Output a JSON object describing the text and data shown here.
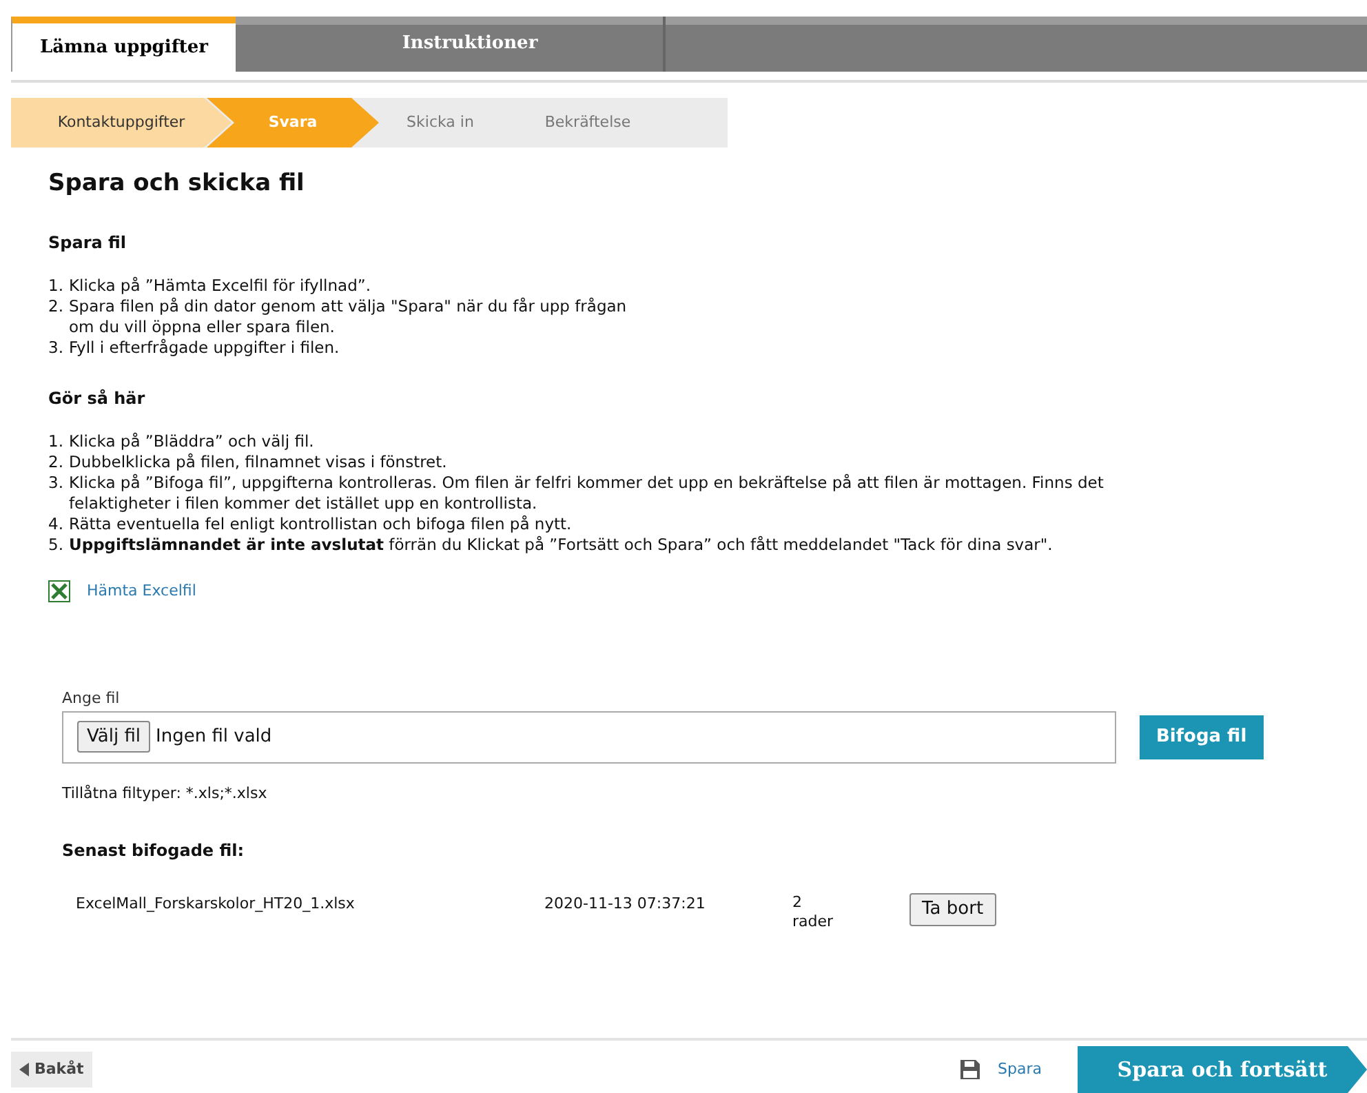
{
  "tabs": [
    {
      "label": "Lämna uppgifter",
      "selected": true
    },
    {
      "label": "Instruktioner",
      "selected": false
    }
  ],
  "steps": [
    {
      "label": "Kontaktuppgifter",
      "kind": "done"
    },
    {
      "label": "Svara",
      "kind": "current"
    },
    {
      "label": "Skicka in",
      "kind": "pending"
    },
    {
      "label": "Bekräftelse",
      "kind": "pending"
    }
  ],
  "title": "Spara och skicka fil",
  "sections": [
    {
      "heading": "Spara fil",
      "items": [
        {
          "number": "1.",
          "text": "Klicka på ”Hämta Excelfil för ifyllnad”."
        },
        {
          "number": "2.",
          "text": "Spara filen på din dator genom att välja \"Spara\" när du får upp frågan om du vill öppna eller spara filen."
        },
        {
          "number": "3.",
          "text": "Fyll i efterfrågade uppgifter i filen."
        }
      ]
    },
    {
      "heading": "Gör så här",
      "items": [
        {
          "number": "1.",
          "text": "Klicka på ”Bläddra” och välj fil."
        },
        {
          "number": "2.",
          "text": "Dubbelklicka på filen, filnamnet visas i fönstret."
        },
        {
          "number": "3.",
          "text": "Klicka på ”Bifoga fil”, uppgifterna kontrolleras. Om filen är felfri kommer det upp en bekräftelse på att filen är mottagen. Finns det felaktigheter i filen kommer det istället upp en kontrollista."
        },
        {
          "number": "4.",
          "text": "Rätta eventuella fel enligt kontrollistan och bifoga filen på nytt."
        },
        {
          "number": "5.",
          "text": "**Uppgiftslämnandet är inte avslutat** förrän du Klickat på ”Fortsätt och Spara” och fått meddelandet \"Tack för dina svar\"."
        }
      ]
    }
  ],
  "download_link": "Hämta Excelfil",
  "file_field": {
    "label": "Ange fil",
    "choose_button": "Välj fil",
    "value": "Ingen fil vald"
  },
  "attach_button": "Bifoga fil",
  "allowed_types": "Tillåtna filtyper: *.xls;*.xlsx",
  "recent": {
    "heading": "Senast bifogade fil:",
    "files": [
      {
        "name": "ExcelMall_Forskarskolor_HT20_1.xlsx",
        "date": "2020-11-13 07:37:21",
        "rows": "2 rader",
        "remove_button": "Ta bort"
      }
    ]
  },
  "footer": {
    "back": "Bakåt",
    "save": "Spara",
    "continue": "Spara och fortsätt"
  }
}
